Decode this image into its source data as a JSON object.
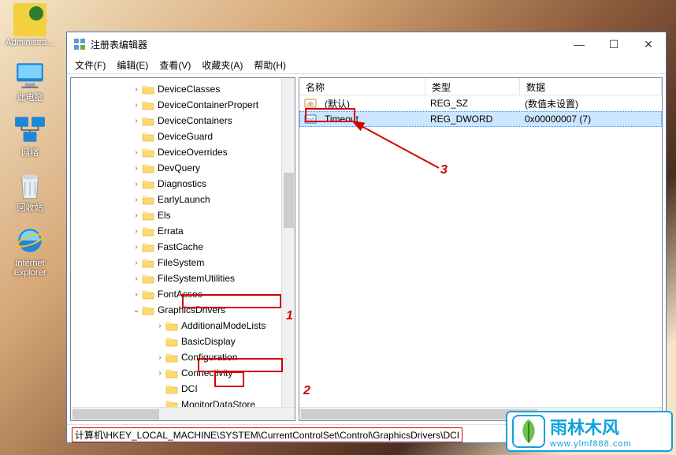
{
  "desktop": {
    "icons": [
      {
        "label": "Administra..."
      },
      {
        "label": "此电脑"
      },
      {
        "label": "网络"
      },
      {
        "label": "回收站"
      },
      {
        "label": "Internet\nExplorer"
      }
    ]
  },
  "window": {
    "title": "注册表编辑器",
    "menus": {
      "file": "文件(F)",
      "edit": "编辑(E)",
      "view": "查看(V)",
      "favorites": "收藏夹(A)",
      "help": "帮助(H)"
    },
    "tree": [
      {
        "label": "DeviceClasses",
        "depth": 1,
        "twisty": ">"
      },
      {
        "label": "DeviceContainerPropert",
        "depth": 1,
        "twisty": ">"
      },
      {
        "label": "DeviceContainers",
        "depth": 1,
        "twisty": ">"
      },
      {
        "label": "DeviceGuard",
        "depth": 1,
        "twisty": ""
      },
      {
        "label": "DeviceOverrides",
        "depth": 1,
        "twisty": ">"
      },
      {
        "label": "DevQuery",
        "depth": 1,
        "twisty": ">"
      },
      {
        "label": "Diagnostics",
        "depth": 1,
        "twisty": ">"
      },
      {
        "label": "EarlyLaunch",
        "depth": 1,
        "twisty": ">"
      },
      {
        "label": "Els",
        "depth": 1,
        "twisty": ">"
      },
      {
        "label": "Errata",
        "depth": 1,
        "twisty": ">"
      },
      {
        "label": "FastCache",
        "depth": 1,
        "twisty": ">"
      },
      {
        "label": "FileSystem",
        "depth": 1,
        "twisty": ">"
      },
      {
        "label": "FileSystemUtilities",
        "depth": 1,
        "twisty": ">"
      },
      {
        "label": "FontAssoc",
        "depth": 1,
        "twisty": ">"
      },
      {
        "label": "GraphicsDrivers",
        "depth": 1,
        "twisty": "v"
      },
      {
        "label": "AdditionalModeLists",
        "depth": 2,
        "twisty": ">"
      },
      {
        "label": "BasicDisplay",
        "depth": 2,
        "twisty": ""
      },
      {
        "label": "Configuration",
        "depth": 2,
        "twisty": ">"
      },
      {
        "label": "Connectivity",
        "depth": 2,
        "twisty": ">"
      },
      {
        "label": "DCI",
        "depth": 2,
        "twisty": ""
      },
      {
        "label": "MonitorDataStore",
        "depth": 2,
        "twisty": ""
      }
    ],
    "columns": {
      "name": "名称",
      "type": "类型",
      "data": "数据"
    },
    "values": [
      {
        "name": "(默认)",
        "type": "REG_SZ",
        "data": "(数值未设置)",
        "icon": "ab",
        "selected": false
      },
      {
        "name": "Timeout",
        "type": "REG_DWORD",
        "data": "0x00000007 (7)",
        "icon": "110",
        "selected": true
      }
    ],
    "status": "计算机\\HKEY_LOCAL_MACHINE\\SYSTEM\\CurrentControlSet\\Control\\GraphicsDrivers\\DCI"
  },
  "annotations": {
    "num1": "1",
    "num2": "2",
    "num3": "3"
  },
  "logo": {
    "text": "雨林木风",
    "url": "www.ylmf888.com"
  }
}
